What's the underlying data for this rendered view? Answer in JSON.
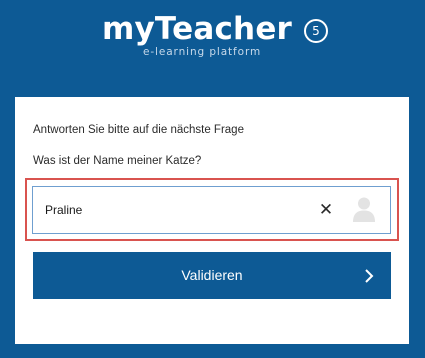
{
  "brand": {
    "name": "myTeacher",
    "badge": "5",
    "tagline": "e-learning platform"
  },
  "form": {
    "instruction": "Antworten Sie bitte auf die nächste Frage",
    "question": "Was ist der Name meiner Katze?",
    "answer_value": "Praline",
    "clear_symbol": "✕",
    "submit_label": "Validieren"
  },
  "colors": {
    "brand_blue": "#0d5a95",
    "highlight_red": "#d9534f",
    "field_border": "#6f9fd0"
  },
  "icons": {
    "clear": "close-icon",
    "user": "user-icon",
    "submit": "chevron-right-icon"
  }
}
